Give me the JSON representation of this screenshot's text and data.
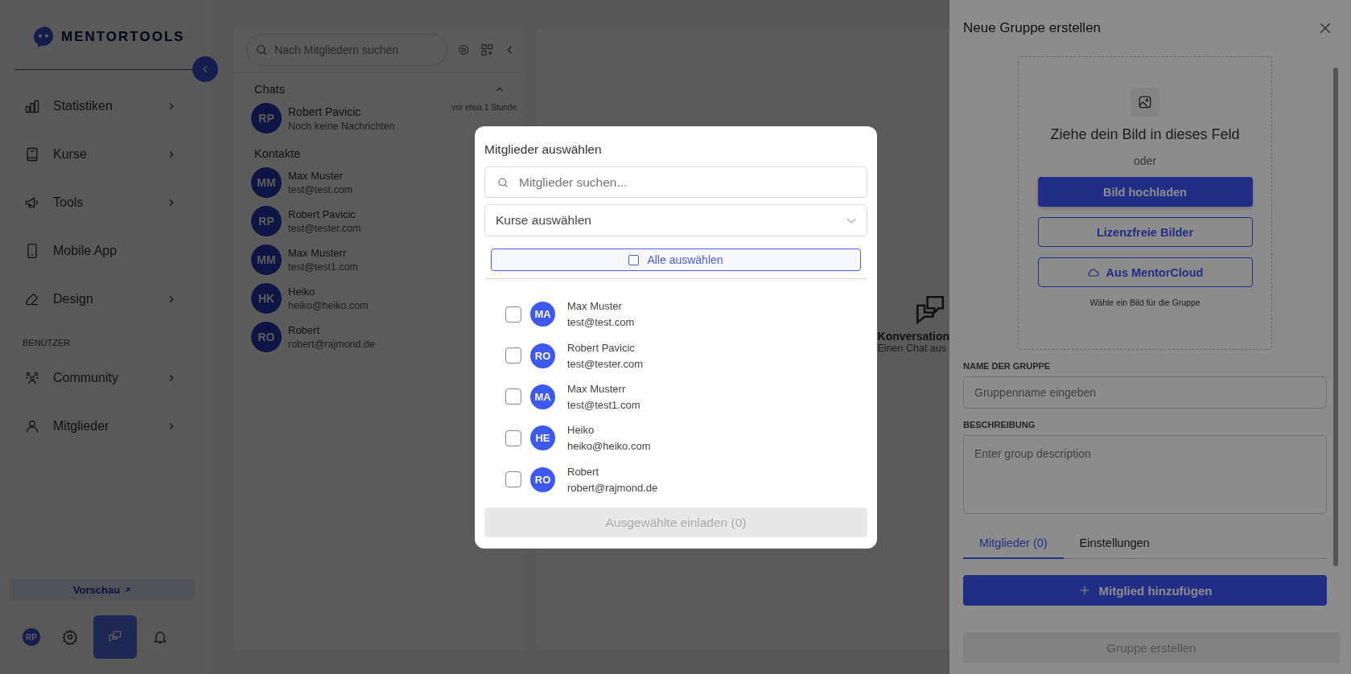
{
  "sidebar": {
    "logo": "MENTORTOOLS",
    "nav": [
      {
        "label": "Statistiken",
        "kind": "chart",
        "has_submenu": true
      },
      {
        "label": "Kurse",
        "kind": "book",
        "has_submenu": true
      },
      {
        "label": "Tools",
        "kind": "megaphone",
        "has_submenu": true
      },
      {
        "label": "Mobile App",
        "kind": "phone",
        "has_submenu": false
      },
      {
        "label": "Design",
        "kind": "pen",
        "has_submenu": true
      }
    ],
    "section": "BENUTZER",
    "user_nav": [
      {
        "label": "Community",
        "kind": "people",
        "has_submenu": true
      },
      {
        "label": "Mitglieder",
        "kind": "person",
        "has_submenu": true
      }
    ],
    "preview": "Vorschau",
    "avatar": "RP",
    "bottom_nav": [
      {
        "kind": "settings",
        "selected": false
      },
      {
        "kind": "chat",
        "selected": true
      },
      {
        "kind": "bell",
        "selected": false
      }
    ]
  },
  "chat_list": {
    "search": {
      "placeholder": "Nach Mitgliedern suchen"
    },
    "chats_heading": "Chats",
    "chats": [
      {
        "initials": "RP",
        "name": "Robert Pavicic",
        "preview": "Noch keine Nachrichten",
        "time": "vor etwa 1 Stunde"
      }
    ],
    "contacts_heading": "Kontakte",
    "contacts": [
      {
        "initials": "MM",
        "name": "Max Muster",
        "email": "test@test.com"
      },
      {
        "initials": "RP",
        "name": "Robert Pavicic",
        "email": "test@tester.com"
      },
      {
        "initials": "MM",
        "name": "Max Musterr",
        "email": "test@test1.com"
      },
      {
        "initials": "HK",
        "name": "Heiko",
        "email": "heiko@heiko.com"
      },
      {
        "initials": "RO",
        "name": "Robert",
        "email": "robert@rajmond.de"
      }
    ]
  },
  "conversation": {
    "title": "Konversation",
    "subtitle": "Einen Chat aus"
  },
  "drawer": {
    "title": "Neue Gruppe erstellen",
    "upload": {
      "prompt": "Ziehe dein Bild in dieses Feld",
      "or": "oder",
      "buttons": [
        {
          "label": "Bild hochladen",
          "kind": "primary"
        },
        {
          "label": "Lizenzfreie Bilder",
          "kind": "outline"
        },
        {
          "label": "Aus MentorCloud",
          "kind": "cloud"
        }
      ],
      "hint": "Wähle ein Bild für die Gruppe"
    },
    "name_label": "NAME DER GRUPPE",
    "name": {
      "placeholder": "Gruppenname eingeben"
    },
    "description_label": "BESCHREIBUNG",
    "description": {
      "placeholder": "Enter group description"
    },
    "tabs": [
      {
        "label": "Mitglieder (0)",
        "selected": true
      },
      {
        "label": "Einstellungen",
        "selected": false
      }
    ],
    "add_button": "Mitglied hinzufügen",
    "submit": {
      "label": "Gruppe erstellen",
      "disabled": true
    }
  },
  "modal": {
    "title": "Mitglieder auswählen",
    "search": {
      "placeholder": "Mitglieder suchen..."
    },
    "course_select": "Kurse auswählen",
    "select_all": {
      "label": "Alle auswählen",
      "checked": false
    },
    "members": [
      {
        "initials": "MA",
        "name": "Max Muster",
        "email": "test@test.com",
        "checked": false
      },
      {
        "initials": "RO",
        "name": "Robert Pavicic",
        "email": "test@tester.com",
        "checked": false
      },
      {
        "initials": "MA",
        "name": "Max Musterr",
        "email": "test@test1.com",
        "checked": false
      },
      {
        "initials": "HE",
        "name": "Heiko",
        "email": "heiko@heiko.com",
        "checked": false
      },
      {
        "initials": "RO",
        "name": "Robert",
        "email": "robert@rajmond.de",
        "checked": false
      }
    ],
    "invite": {
      "label": "Ausgewählte einladen (0)",
      "disabled": true
    }
  }
}
